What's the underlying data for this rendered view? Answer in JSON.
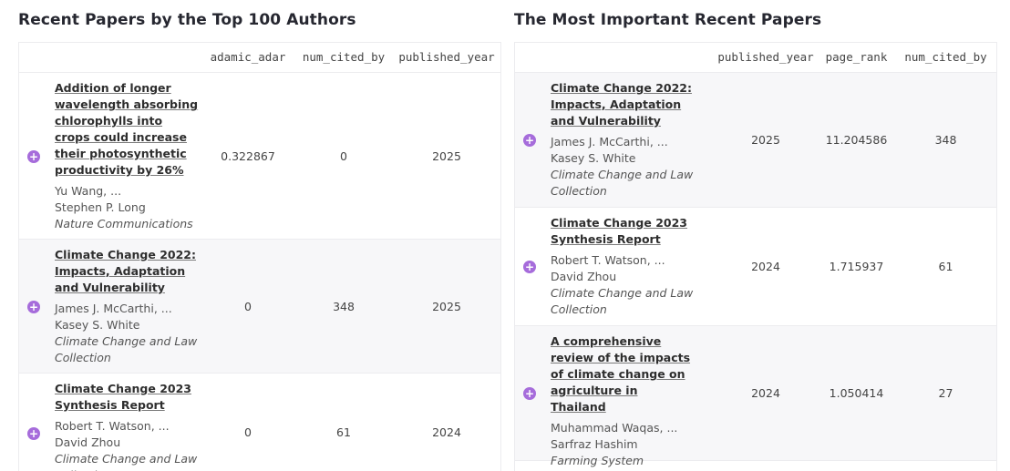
{
  "left_panel": {
    "title": "Recent Papers by the Top 100 Authors",
    "columns": [
      "adamic_adar",
      "num_cited_by",
      "published_year"
    ],
    "rows": [
      {
        "title": "Addition of longer wavelength absorbing chlorophylls into crops could increase their photosynthetic productivity by 26%",
        "author_first": "Yu Wang, ...",
        "author_last": "Stephen P. Long",
        "venue": "Nature Communications",
        "values": [
          "0.322867",
          "0",
          "2025"
        ]
      },
      {
        "title": "Climate Change 2022: Impacts, Adaptation and Vulnerability",
        "author_first": "James J. McCarthi, ...",
        "author_last": "Kasey S. White",
        "venue": "Climate Change and Law Collection",
        "values": [
          "0",
          "348",
          "2025"
        ]
      },
      {
        "title": "Climate Change 2023 Synthesis Report",
        "author_first": "Robert T. Watson, ...",
        "author_last": "David Zhou",
        "venue": "Climate Change and Law Collection",
        "values": [
          "0",
          "61",
          "2024"
        ]
      }
    ]
  },
  "right_panel": {
    "title": "The Most Important Recent Papers",
    "columns": [
      "published_year",
      "page_rank",
      "num_cited_by"
    ],
    "rows": [
      {
        "title": "Climate Change 2022: Impacts, Adaptation and Vulnerability",
        "author_first": "James J. McCarthi, ...",
        "author_last": "Kasey S. White",
        "venue": "Climate Change and Law Collection",
        "values": [
          "2025",
          "11.204586",
          "348"
        ]
      },
      {
        "title": "Climate Change 2023 Synthesis Report",
        "author_first": "Robert T. Watson, ...",
        "author_last": "David Zhou",
        "venue": "Climate Change and Law Collection",
        "values": [
          "2024",
          "1.715937",
          "61"
        ]
      },
      {
        "title": "A comprehensive review of the impacts of climate change on agriculture in Thailand",
        "author_first": "Muhammad Waqas, ...",
        "author_last": "Sarfraz Hashim",
        "venue": "Farming System",
        "values": [
          "2024",
          "1.050414",
          "27"
        ]
      }
    ]
  },
  "icons": {
    "expand": "plus-circle-icon"
  },
  "colors": {
    "accent": "#a66cdb",
    "alt_row": "#f7f7f9",
    "border": "#ececef"
  }
}
